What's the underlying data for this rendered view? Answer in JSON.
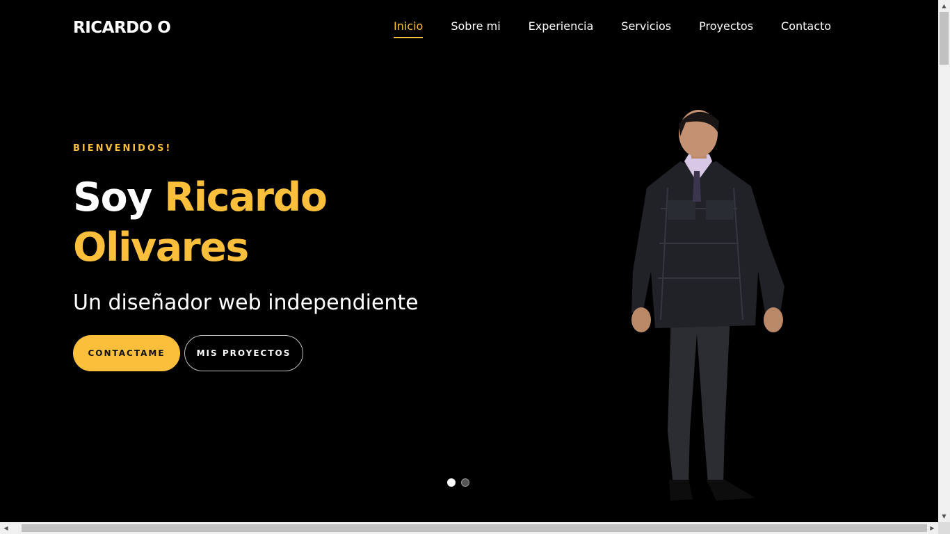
{
  "header": {
    "logo": "RICARDO O",
    "nav": [
      {
        "label": "Inicio",
        "active": true
      },
      {
        "label": "Sobre mi",
        "active": false
      },
      {
        "label": "Experiencia",
        "active": false
      },
      {
        "label": "Servicios",
        "active": false
      },
      {
        "label": "Proyectos",
        "active": false
      },
      {
        "label": "Contacto",
        "active": false
      }
    ]
  },
  "hero": {
    "eyebrow": "BIENVENIDOS!",
    "headline_prefix": "Soy",
    "headline_name": "Ricardo Olivares",
    "subtitle": "Un diseñador web independiente",
    "primary_button": "CONTACTAME",
    "secondary_button": "MIS PROYECTOS",
    "image": "portrait-photo"
  },
  "carousel": {
    "slide_count": 2,
    "active_index": 0
  },
  "colors": {
    "background": "#000000",
    "accent": "#fbbf3c",
    "text": "#ffffff"
  },
  "icons": {
    "scroll_up": "chevron-up-icon",
    "scroll_down": "chevron-down-icon",
    "scroll_left": "chevron-left-icon",
    "scroll_right": "chevron-right-icon"
  }
}
